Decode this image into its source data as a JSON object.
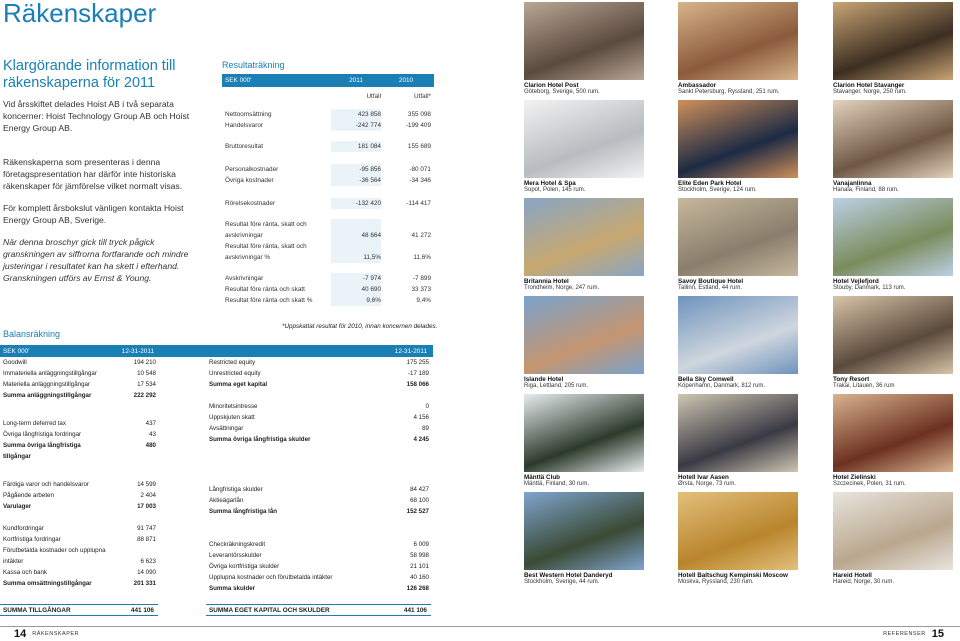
{
  "page_title": "Räkenskaper",
  "intro": {
    "heading": "Klargörande information till räkenskaperna för 2011",
    "p1": "Vid årsskiftet delades Hoist AB i två separata koncerner: Hoist Technology Group AB och Hoist Energy Group AB.",
    "p2": "Räkenskaperna som presenteras i denna företagspresentation har därför inte historiska räkenskaper för jämförelse vilket normalt visas.",
    "p3": "För komplett årsbokslut vänligen kontakta Hoist Energy Group AB, Sverige.",
    "p4": "När denna broschyr gick till tryck pågick granskningen av siffrorna fortfarande och mindre justeringar i resultatet kan ha skett i efterhand. Granskningen utförs av Ernst & Young."
  },
  "income": {
    "title": "Resultaträkning",
    "hdr_label": "SEK 000'",
    "hdr_y1": "2011",
    "hdr_y2": "2010",
    "sub_y1": "Utfall",
    "sub_y2": "Utfall*",
    "rows": [
      {
        "label": "Nettoomsättning",
        "v1": "423 858",
        "v2": "355 098"
      },
      {
        "label": "Handelsvaror",
        "v1": "-242 774",
        "v2": "-199 409"
      },
      {
        "label": "Bruttoresultat",
        "v1": "181 084",
        "v2": "155 689"
      },
      {
        "label": "Personalkostnader",
        "v1": "-95 856",
        "v2": "-80 071"
      },
      {
        "label": "Övriga kostnader",
        "v1": "-36 564",
        "v2": "-34 346"
      },
      {
        "label": "Rörelsekostnader",
        "v1": "-132 420",
        "v2": "-114 417"
      },
      {
        "label": "Resultat före ränta, skatt och",
        "v1": "",
        "v2": ""
      },
      {
        "label": "avskrivningar",
        "v1": "48 664",
        "v2": "41 272"
      },
      {
        "label": "Resultat före ränta, skatt och",
        "v1": "",
        "v2": ""
      },
      {
        "label": "avskrivningar %",
        "v1": "11,5%",
        "v2": "11,6%"
      },
      {
        "label": "Avskrivningar",
        "v1": "-7 974",
        "v2": "-7 899"
      },
      {
        "label": "Resultat före ränta och skatt",
        "v1": "40 690",
        "v2": "33 373"
      },
      {
        "label": "Resultat före ränta och skatt %",
        "v1": "9,6%",
        "v2": "9,4%"
      }
    ],
    "footnote": "*Uppskattat resultat för 2010, innan koncernen delades."
  },
  "balance": {
    "title": "Balansräkning",
    "hdr_label": "SEK 000'",
    "hdr_date_left": "12-31-2011",
    "hdr_date_right": "12-31-2011",
    "left": [
      {
        "label": "Goodwill",
        "val": "194 210"
      },
      {
        "label": "Immateriella anläggningstillgångar",
        "val": "10 548"
      },
      {
        "label": "Materiella anläggningstillgångar",
        "val": "17 534"
      },
      {
        "label": "Summa anläggningstillgångar",
        "val": "222 292",
        "bold": true
      },
      {
        "gap": true
      },
      {
        "label": "",
        "val": ""
      },
      {
        "label": "Long-term deferred tax",
        "val": "437"
      },
      {
        "label": "Övriga långfristiga fordringar",
        "val": "43"
      },
      {
        "label": "Summa övriga långfristiga",
        "val": "480",
        "bold": true
      },
      {
        "label": "tillgångar",
        "val": "",
        "bold": true
      },
      {
        "gap": true
      },
      {
        "label": "",
        "val": ""
      },
      {
        "label": "Färdiga varor och handelsvaror",
        "val": "14 599"
      },
      {
        "label": "Pågående arbeten",
        "val": "2 404"
      },
      {
        "label": "Varulager",
        "val": "17 003",
        "bold": true
      },
      {
        "label": "",
        "val": ""
      },
      {
        "label": "Kundfordringar",
        "val": "91 747"
      },
      {
        "label": "Kortfristiga fordringar",
        "val": "88 871"
      },
      {
        "label": "Förutbetalda kostnader och upplupna",
        "val": ""
      },
      {
        "label": "intäkter",
        "val": "6 623"
      },
      {
        "label": "Kassa och bank",
        "val": "14 090"
      },
      {
        "label": "Summa omsättningstillgångar",
        "val": "201 331",
        "bold": true
      }
    ],
    "right": [
      {
        "label": "Restricted equity",
        "val": "175 255"
      },
      {
        "label": "Unrestricted equity",
        "val": "-17 189"
      },
      {
        "label": "Summa eget kapital",
        "val": "158 066",
        "bold": true
      },
      {
        "label": "",
        "val": ""
      },
      {
        "label": "Minoritetsintresse",
        "val": "0"
      },
      {
        "label": "Uppskjuten skatt",
        "val": "4 156"
      },
      {
        "label": "Avsättningar",
        "val": "89"
      },
      {
        "label": "Summa övriga långfristiga skulder",
        "val": "4 245",
        "bold": true
      },
      {
        "gap": true
      },
      {
        "label": "",
        "val": ""
      },
      {
        "label": "",
        "val": ""
      },
      {
        "label": "",
        "val": ""
      },
      {
        "label": "Långfristiga skulder",
        "val": "84 427"
      },
      {
        "label": "Aktieägarlån",
        "val": "68 100"
      },
      {
        "label": "Summa långfristiga lån",
        "val": "152 527",
        "bold": true
      },
      {
        "label": "",
        "val": ""
      },
      {
        "label": "",
        "val": ""
      },
      {
        "label": "Checkräkningskredit",
        "val": "6 009"
      },
      {
        "label": "Leverantörsskulder",
        "val": "58 998"
      },
      {
        "label": "Övriga kortfristiga skulder",
        "val": "21 101"
      },
      {
        "label": "Upplupna kostnader och förutbetalda intäkter",
        "val": "40 160"
      },
      {
        "label": "Summa skulder",
        "val": "126 268",
        "bold": true
      }
    ],
    "total_left_label": "SUMMA TILLGÅNGAR",
    "total_left_val": "441 106",
    "total_right_label": "SUMMA EGET KAPITAL OCH SKULDER",
    "total_right_val": "441 106"
  },
  "hotels": [
    {
      "name": "Clarion Hotel Post",
      "loc": "Göteborg, Sverige, 500 rum.",
      "c1": "#5a4a3e",
      "c2": "#b9a795"
    },
    {
      "name": "Ambassador",
      "loc": "Sankt Petersburg, Ryssland, 251 rum.",
      "c1": "#8b5a3c",
      "c2": "#d7b48a"
    },
    {
      "name": "Clarion Hotel Stavanger",
      "loc": "Stavanger, Norge, 250 rum.",
      "c1": "#3c2e22",
      "c2": "#c8a574"
    },
    {
      "name": "Mera Hotel & Spa",
      "loc": "Sopot, Polen, 145 rum.",
      "c1": "#b8bcc0",
      "c2": "#f2f2f2"
    },
    {
      "name": "Elite Eden Park Hotel",
      "loc": "Stockholm, Sverige, 124 rum.",
      "c1": "#1c2a44",
      "c2": "#d0905a"
    },
    {
      "name": "Vanajanlinna",
      "loc": "Hanala, Finland, 88 rum.",
      "c1": "#6e5844",
      "c2": "#e4d2bc"
    },
    {
      "name": "Britannia Hotel",
      "loc": "Trondheim, Norge, 247 rum.",
      "c1": "#c7a870",
      "c2": "#88a6c6"
    },
    {
      "name": "Savoy Boutique Hotel",
      "loc": "Tallinn, Estland, 44 rum.",
      "c1": "#8a7d6c",
      "c2": "#c6b89c"
    },
    {
      "name": "Hotel Vejlefjord",
      "loc": "Stouby, Danmark, 113 rum.",
      "c1": "#7a8c5c",
      "c2": "#bcd0e6"
    },
    {
      "name": "Islande Hotel",
      "loc": "Riga, Lettland, 205 rum.",
      "c1": "#c49570",
      "c2": "#7aa3cc"
    },
    {
      "name": "Bella Sky Comwell",
      "loc": "Köpenhamn, Danmark, 812 rum.",
      "c1": "#cfd6de",
      "c2": "#6f93bd"
    },
    {
      "name": "Tony Resort",
      "loc": "Trakai, Litauen, 36 rum",
      "c1": "#5a4a3c",
      "c2": "#d8c4a8"
    },
    {
      "name": "Mänttä Club",
      "loc": "Mänttä, Finland, 30 rum.",
      "c1": "#2c3a2a",
      "c2": "#e7ecef"
    },
    {
      "name": "Hotell Ivar Aasen",
      "loc": "Ørsta, Norge, 73 rum.",
      "c1": "#3a3a44",
      "c2": "#cfc6b2"
    },
    {
      "name": "Hotel Zielinski",
      "loc": "Szczecinek, Polen, 31 rum.",
      "c1": "#6c3020",
      "c2": "#d8b490"
    },
    {
      "name": "Best Western Hotel Danderyd",
      "loc": "Stockholm, Sverige, 44 rum.",
      "c1": "#3a4a34",
      "c2": "#7fa4cf"
    },
    {
      "name": "Hotell Baltschug Kempinski Moscow",
      "loc": "Moskva, Ryssland, 230 rum.",
      "c1": "#b9852c",
      "c2": "#e2c07c"
    },
    {
      "name": "Hareid Hotell",
      "loc": "Hareid, Norge, 30 rum.",
      "c1": "#b9a78e",
      "c2": "#e8e4de"
    }
  ],
  "footer": {
    "left_page": "14",
    "left_label": "RÄKENSKAPER",
    "right_label": "REFERENSER",
    "right_page": "15"
  },
  "colors": {
    "accent": "#1a7fb5",
    "shade": "#eaf3f8"
  }
}
